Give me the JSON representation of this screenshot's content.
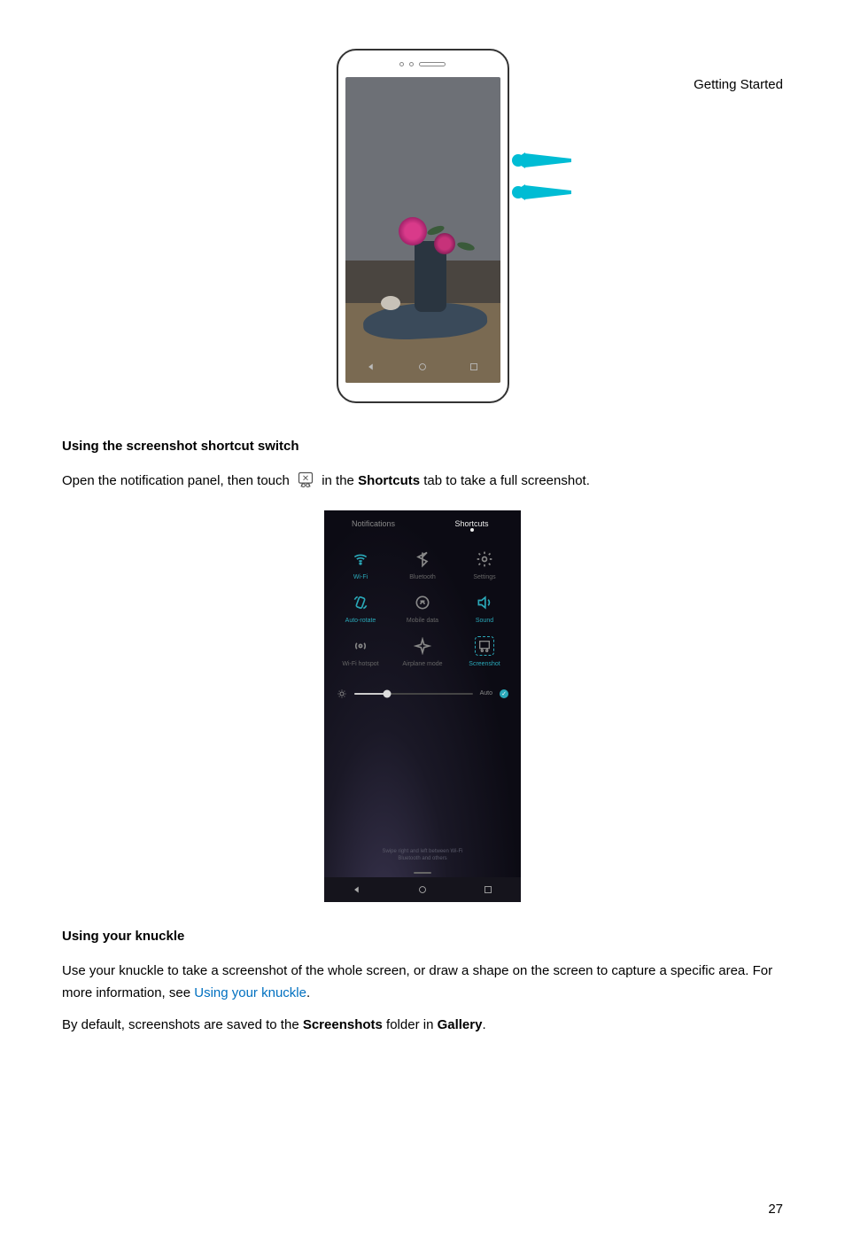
{
  "header": {
    "section": "Getting Started"
  },
  "page_number": "27",
  "section1": {
    "heading": "Using the screenshot shortcut switch",
    "para_before": "Open the notification panel, then touch ",
    "para_mid_a": " in the ",
    "bold1": "Shortcuts",
    "para_after": " tab to take a full screenshot."
  },
  "panel": {
    "tabs": {
      "notifications": "Notifications",
      "shortcuts": "Shortcuts"
    },
    "tiles": {
      "wifi": "Wi-Fi",
      "bluetooth": "Bluetooth",
      "settings": "Settings",
      "autorotate": "Auto-rotate",
      "mobiledata": "Mobile data",
      "sound": "Sound",
      "hotspot": "Wi-Fi hotspot",
      "airplane": "Airplane mode",
      "screenshot": "Screenshot"
    },
    "brightness_auto": "Auto",
    "footer_line1": "Swipe right and left between Wi-Fi",
    "footer_line2": "Bluetooth and others"
  },
  "section2": {
    "heading": "Using your knuckle",
    "p1_a": "Use your knuckle to take a screenshot of the whole screen, or draw a shape on the screen to capture a specific area. For more information, see ",
    "p1_link": "Using your knuckle",
    "p1_b": ".",
    "p2_a": "By default, screenshots are saved to the ",
    "p2_bold1": "Screenshots",
    "p2_b": " folder in ",
    "p2_bold2": "Gallery",
    "p2_c": "."
  }
}
